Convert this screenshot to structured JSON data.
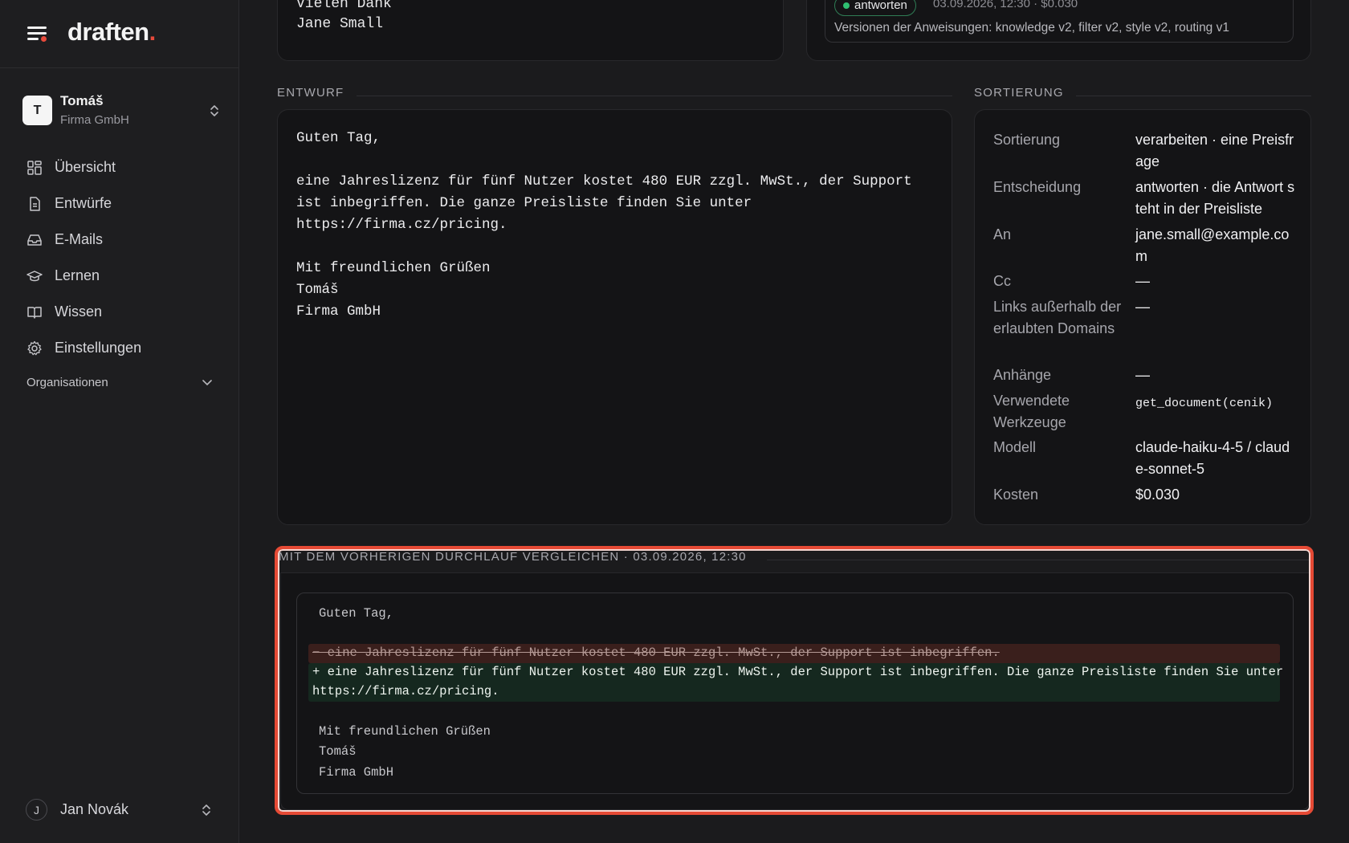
{
  "brand": {
    "name": "draften",
    "dot": "."
  },
  "account": {
    "initial": "T",
    "name": "Tomáš",
    "org": "Firma GmbH"
  },
  "nav": [
    {
      "label": "Übersicht",
      "icon": "dashboard-icon"
    },
    {
      "label": "Entwürfe",
      "icon": "document-icon"
    },
    {
      "label": "E-Mails",
      "icon": "inbox-icon"
    },
    {
      "label": "Lernen",
      "icon": "graduation-cap-icon"
    },
    {
      "label": "Wissen",
      "icon": "book-icon"
    },
    {
      "label": "Einstellungen",
      "icon": "gear-icon"
    }
  ],
  "organizations": {
    "label": "Organisationen"
  },
  "user": {
    "initial": "J",
    "name": "Jan Novák"
  },
  "top_email": {
    "line1": "Vielen Dank",
    "line2": "Jane Small"
  },
  "top_status": {
    "pill": "antworten",
    "meta": "03.09.2026, 12:30 · $0.030",
    "versions": "Versionen der Anweisungen: knowledge v2, filter v2, style v2, routing v1"
  },
  "draft": {
    "label": "Entwurf",
    "text": "Guten Tag,\n\neine Jahreslizenz für fünf Nutzer kostet 480 EUR zzgl. MwSt., der Support\nist inbegriffen. Die ganze Preisliste finden Sie unter\nhttps://firma.cz/pricing.\n\nMit freundlichen Grüßen\nTomáš\nFirma GmbH"
  },
  "sorting": {
    "label": "Sortierung",
    "rows": [
      {
        "key": "Sortierung",
        "value": "verarbeiten · eine Preisfrage"
      },
      {
        "key": "Entscheidung",
        "value": "antworten · die Antwort steht in der Preisliste"
      },
      {
        "key": "An",
        "value": "jane.small@example.com"
      },
      {
        "key": "Cc",
        "value": "—"
      },
      {
        "key": "Links außerhalb der erlaubten Domains",
        "value": "—"
      },
      {
        "key": "Anhänge",
        "value": "—"
      },
      {
        "key": "Verwendete Werkzeuge",
        "value": "get_document(cenik)"
      },
      {
        "key": "Modell",
        "value": "claude-haiku-4-5 / claude-sonnet-5"
      },
      {
        "key": "Kosten",
        "value": "$0.030"
      }
    ]
  },
  "compare": {
    "label": "Mit dem vorherigen Durchlauf vergleichen · 03.09.2026, 12:30",
    "line_greeting": "Guten Tag,",
    "removed": "− eine Jahreslizenz für fünf Nutzer kostet 480 EUR zzgl. MwSt., der Support ist inbegriffen.",
    "added_1": "+ eine Jahreslizenz für fünf Nutzer kostet 480 EUR zzgl. MwSt., der Support ist inbegriffen. Die ganze Preisliste finden Sie unter",
    "added_2": "https://firma.cz/pricing.",
    "closing": "Mit freundlichen Grüßen",
    "sign_name": "Tomáš",
    "sign_org": "Firma GmbH"
  },
  "colors": {
    "accent": "#e74a3b",
    "status_green": "#2fbf71",
    "highlight": "#e64a35"
  }
}
